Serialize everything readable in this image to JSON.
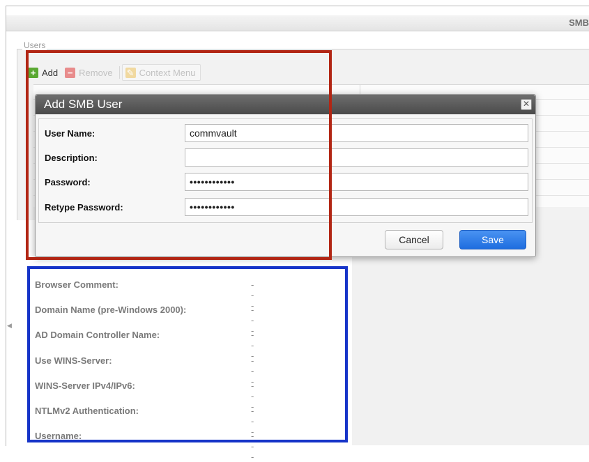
{
  "header": {
    "title": "SMB"
  },
  "users_panel": {
    "label": "Users"
  },
  "toolbar": {
    "add_label": "Add",
    "remove_label": "Remove",
    "context_label": "Context Menu"
  },
  "dialog": {
    "title": "Add SMB User",
    "fields": [
      {
        "label": "User Name:",
        "value": "commvault"
      },
      {
        "label": "Description:",
        "value": ""
      },
      {
        "label": "Password:",
        "value": "••••••••••••"
      },
      {
        "label": "Retype Password:",
        "value": "••••••••••••"
      }
    ],
    "cancel_label": "Cancel",
    "save_label": "Save"
  },
  "info": [
    {
      "key": "Browser Comment:",
      "value": "---"
    },
    {
      "key": "Domain Name (pre-Windows 2000):",
      "value": "---"
    },
    {
      "key": "AD Domain Controller Name:",
      "value": "---"
    },
    {
      "key": "Use WINS-Server:",
      "value": "---"
    },
    {
      "key": "WINS-Server IPv4/IPv6:",
      "value": "---"
    },
    {
      "key": "NTLMv2 Authentication:",
      "value": "---"
    },
    {
      "key": "Username:",
      "value": "---"
    }
  ],
  "colors": {
    "annotation_red": "#b22614",
    "annotation_blue": "#1634c8",
    "save_button": "#1e6ddf"
  }
}
